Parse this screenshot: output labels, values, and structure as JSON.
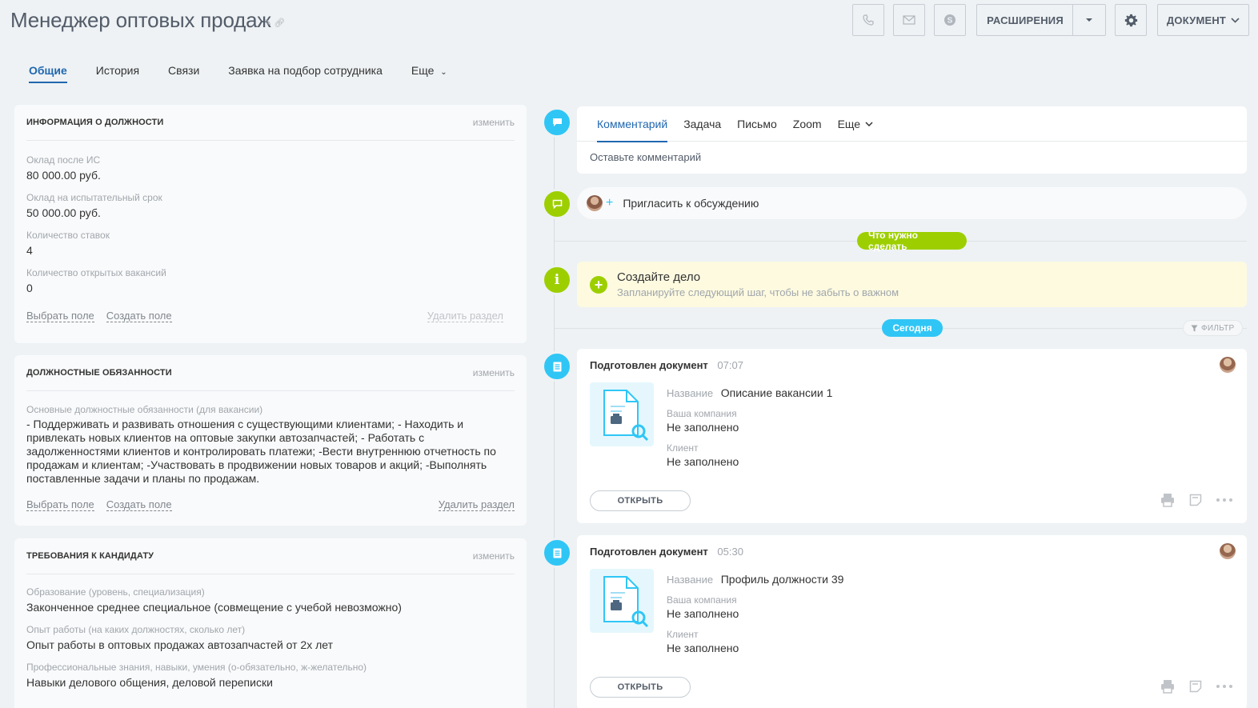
{
  "header": {
    "title": "Менеджер оптовых продаж",
    "extensions_label": "РАСШИРЕНИЯ",
    "document_label": "ДОКУМЕНТ"
  },
  "tabs": [
    {
      "label": "Общие",
      "active": true
    },
    {
      "label": "История"
    },
    {
      "label": "Связи"
    },
    {
      "label": "Заявка на подбор сотрудника"
    },
    {
      "label": "Еще"
    }
  ],
  "sections": {
    "position_info": {
      "title": "ИНФОРМАЦИЯ О ДОЛЖНОСТИ",
      "edit": "изменить",
      "fields": [
        {
          "label": "Оклад после ИС",
          "value": "80 000.00 руб."
        },
        {
          "label": "Оклад на испытательный срок",
          "value": "50 000.00 руб."
        },
        {
          "label": "Количество ставок",
          "value": "4"
        },
        {
          "label": "Количество открытых вакансий",
          "value": "0"
        }
      ],
      "select_field": "Выбрать поле",
      "create_field": "Создать поле",
      "delete_section": "Удалить раздел"
    },
    "duties": {
      "title": "ДОЛЖНОСТНЫЕ ОБЯЗАННОСТИ",
      "edit": "изменить",
      "field_label": "Основные должностные обязанности (для вакансии)",
      "field_value": "- Поддерживать и развивать отношения с существующими клиентами; - Находить и привлекать новых клиентов на оптовые закупки автозапчастей; - Работать с задолженностями клиентов и контролировать платежи; -Вести внутреннюю отчетность по продажам и клиентам; -Участвовать в продвижении новых товаров и акций; -Выполнять поставленные задачи и планы по продажам.",
      "select_field": "Выбрать поле",
      "create_field": "Создать поле",
      "delete_section": "Удалить раздел"
    },
    "requirements": {
      "title": "ТРЕБОВАНИЯ К КАНДИДАТУ",
      "edit": "изменить",
      "fields": [
        {
          "label": "Образование (уровень, специализация)",
          "value": "Законченное среднее специальное (совмещение с учебой невозможно)"
        },
        {
          "label": "Опыт работы (на каких должностях, сколько лет)",
          "value": "Опыт работы в оптовых продажах автозапчастей от 2х лет"
        },
        {
          "label": "Профессиональные знания, навыки, умения (о-обязательно, ж-желательно)",
          "value": "Навыки делового общения, деловой переписки"
        }
      ]
    }
  },
  "timeline": {
    "composer_tabs": [
      "Комментарий",
      "Задача",
      "Письмо",
      "Zoom",
      "Еще"
    ],
    "composer_placeholder": "Оставьте комментарий",
    "invite_label": "Пригласить к обсуждению",
    "todo_pill": "Что нужно сделать",
    "todo_title": "Создайте дело",
    "todo_subtitle": "Запланируйте следующий шаг, чтобы не забыть о важном",
    "today_pill": "Сегодня",
    "filter_label": "ФИЛЬТР",
    "documents": [
      {
        "title": "Подготовлен документ",
        "time": "07:07",
        "name_label": "Название",
        "name_value": "Описание вакансии 1",
        "company_label": "Ваша компания",
        "company_value": "Не заполнено",
        "client_label": "Клиент",
        "client_value": "Не заполнено",
        "open_label": "ОТКРЫТЬ"
      },
      {
        "title": "Подготовлен документ",
        "time": "05:30",
        "name_label": "Название",
        "name_value": "Профиль должности 39",
        "company_label": "Ваша компания",
        "company_value": "Не заполнено",
        "client_label": "Клиент",
        "client_value": "Не заполнено",
        "open_label": "ОТКРЫТЬ"
      }
    ]
  },
  "colors": {
    "accent_blue": "#2067b0",
    "timeline_blue": "#2fc6f6",
    "timeline_green": "#9dcf00",
    "background": "#eef2f4"
  },
  "icons": [
    "pencil-icon",
    "link-icon",
    "phone-icon",
    "mail-icon",
    "skype-icon",
    "dropdown-arrow-icon",
    "gear-icon",
    "chevron-down-icon",
    "comment-icon",
    "chat-icon",
    "info-icon",
    "document-icon",
    "filter-icon",
    "print-icon",
    "note-icon",
    "more-icon"
  ]
}
